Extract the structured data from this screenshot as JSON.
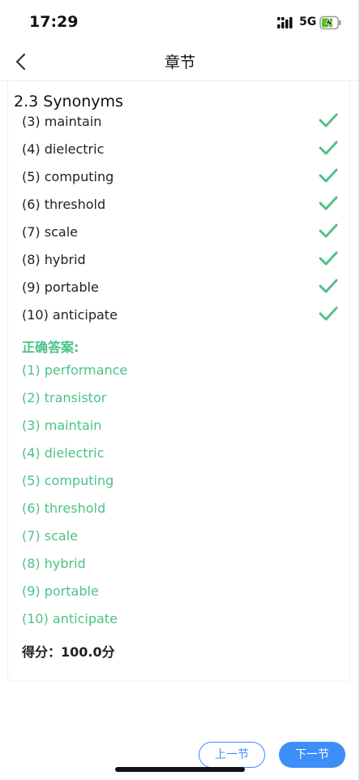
{
  "status_bar": {
    "time": "17:29",
    "network": "5G"
  },
  "nav": {
    "title": "章节"
  },
  "section": {
    "title": "2.3 Synonyms"
  },
  "user_answers": [
    {
      "text": "(3) maintain",
      "correct": true
    },
    {
      "text": "(4) dielectric",
      "correct": true
    },
    {
      "text": "(5) computing",
      "correct": true
    },
    {
      "text": "(6) threshold",
      "correct": true
    },
    {
      "text": "(7) scale",
      "correct": true
    },
    {
      "text": "(8) hybrid",
      "correct": true
    },
    {
      "text": "(9) portable",
      "correct": true
    },
    {
      "text": "(10) anticipate",
      "correct": true
    }
  ],
  "correct_answers": {
    "title": "正确答案:",
    "items": [
      "(1) performance",
      "(2) transistor",
      "(3) maintain",
      "(4) dielectric",
      "(5) computing",
      "(6) threshold",
      "(7) scale",
      "(8) hybrid",
      "(9) portable",
      "(10) anticipate"
    ]
  },
  "score": {
    "text": "得分：100.0分"
  },
  "buttons": {
    "prev_label": "上一节",
    "next_label": "下一节"
  },
  "colors": {
    "accent": "#3d8ef7",
    "correct": "#4cc286",
    "check": "#52c08a"
  },
  "icons": {
    "back": "chevron-left-icon",
    "check": "check-icon",
    "signal": "signal-icon",
    "battery": "battery-charging-icon"
  }
}
